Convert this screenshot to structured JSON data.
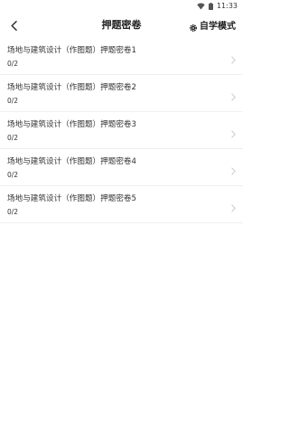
{
  "status_bar": {
    "time": "11:33",
    "wifi_icon": "wifi-icon",
    "battery_icon": "battery-icon"
  },
  "header": {
    "title": "押题密卷",
    "back_icon": "back-chevron-icon",
    "mode_label": "自学模式",
    "mode_icon": "gear-icon"
  },
  "papers": [
    {
      "title": "场地与建筑设计（作图题）押题密卷1",
      "progress": "0/2"
    },
    {
      "title": "场地与建筑设计（作图题）押题密卷2",
      "progress": "0/2"
    },
    {
      "title": "场地与建筑设计（作图题）押题密卷3",
      "progress": "0/2"
    },
    {
      "title": "场地与建筑设计（作图题）押题密卷4",
      "progress": "0/2"
    },
    {
      "title": "场地与建筑设计（作图题）押题密卷5",
      "progress": "0/2"
    }
  ],
  "colors": {
    "background": "#ffffff",
    "text": "#333333",
    "divider": "#f0f0f0",
    "chevron": "#cccccc"
  }
}
